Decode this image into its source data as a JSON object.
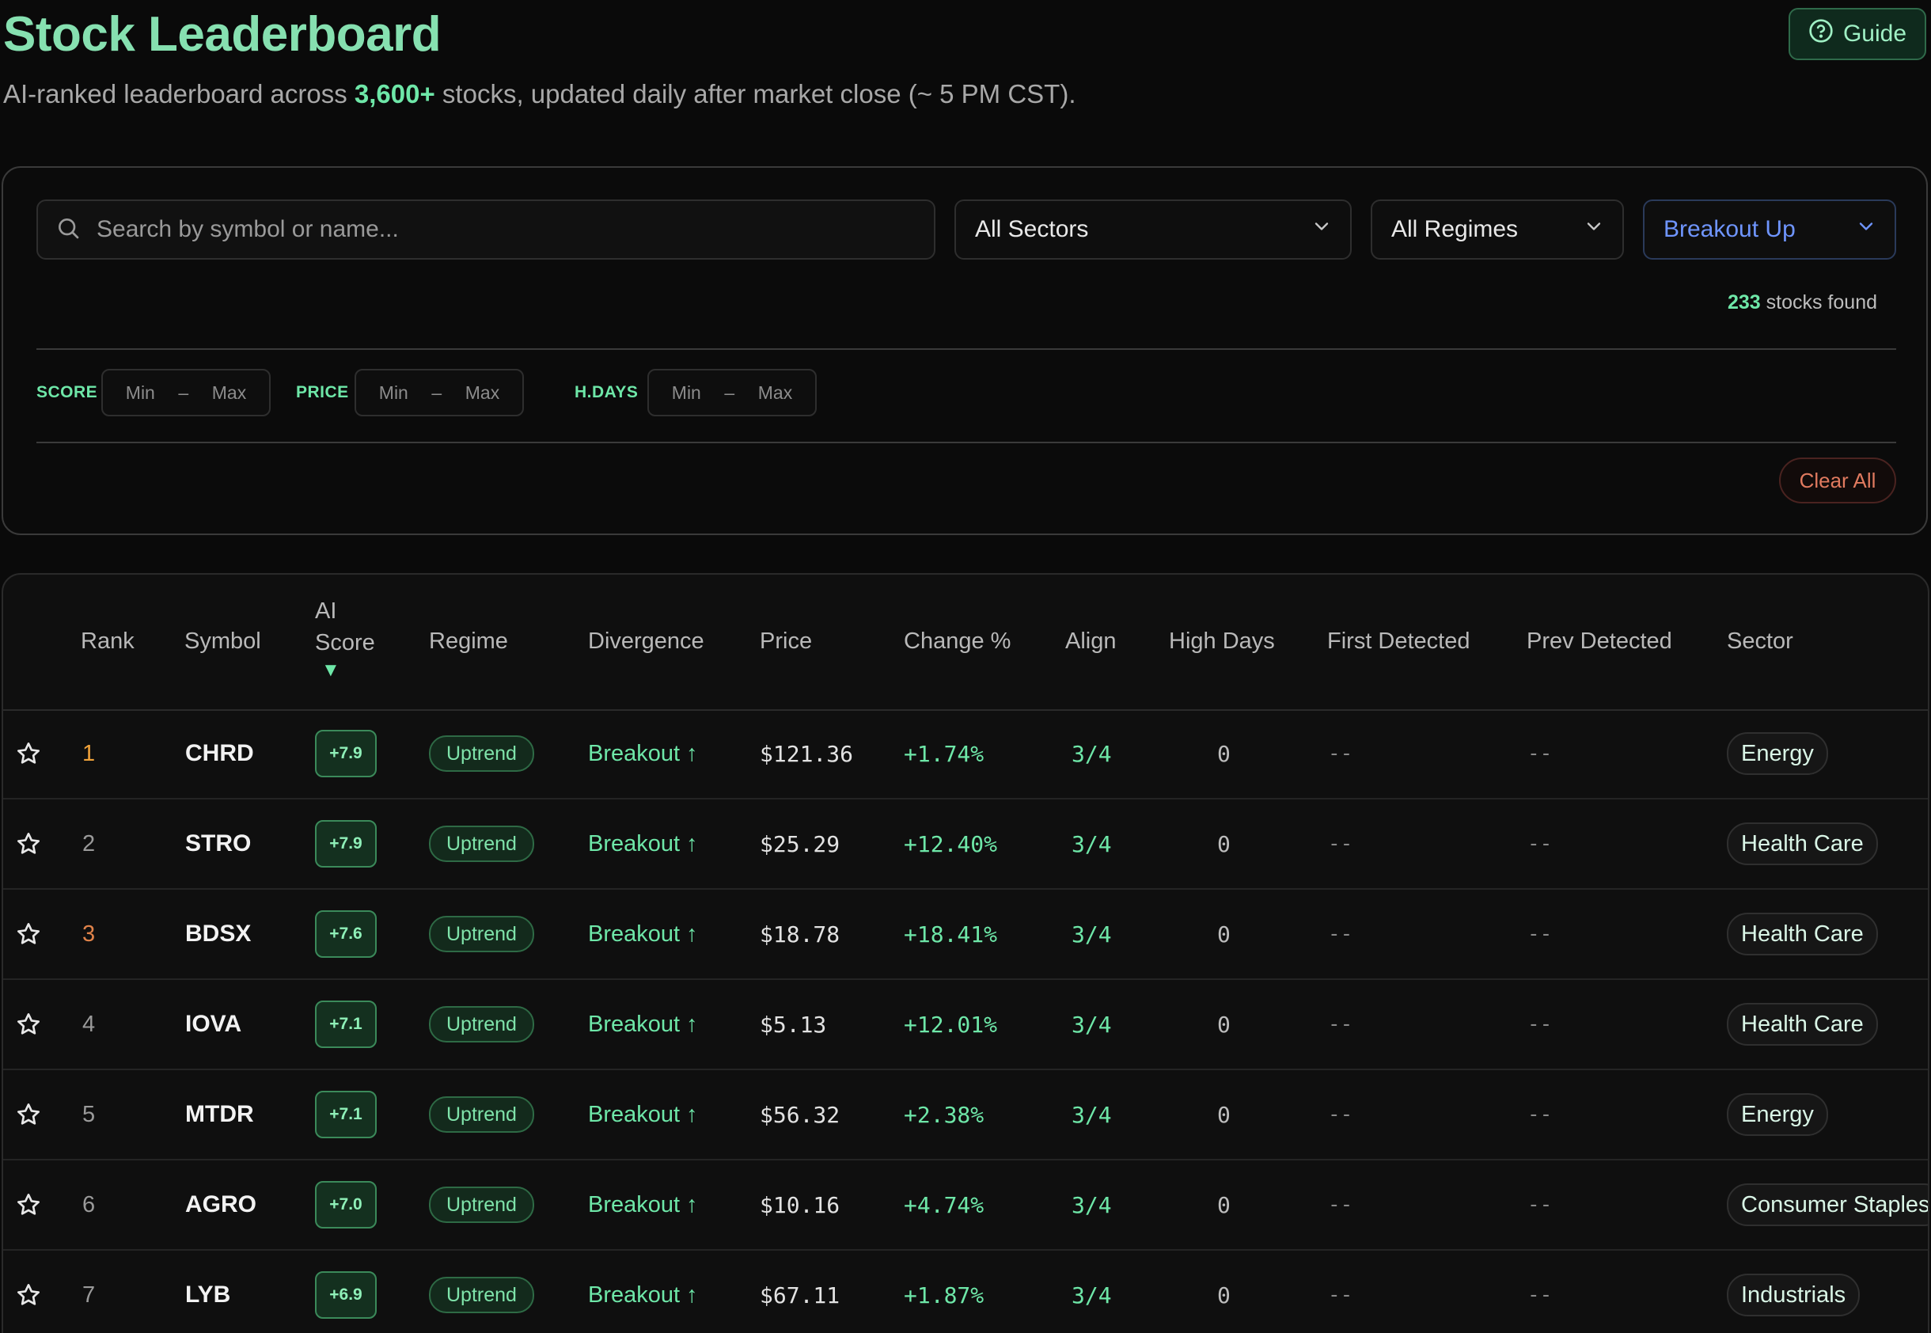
{
  "header": {
    "title": "Stock Leaderboard",
    "subtitle_prefix": "AI-ranked leaderboard across ",
    "subtitle_highlight": "3,600+",
    "subtitle_suffix": " stocks, updated daily after market close (~ 5 PM CST).",
    "guide_label": "Guide",
    "guide_icon": "help-circle-icon"
  },
  "filters": {
    "search_placeholder": "Search by symbol or name...",
    "search_value": "",
    "sector_selected": "All Sectors",
    "regime_selected": "All Regimes",
    "signal_selected": "Breakout Up",
    "found_count": "233",
    "found_label": "stocks found",
    "ranges": [
      {
        "label": "SCORE",
        "min": "Min",
        "sep": "–",
        "max": "Max"
      },
      {
        "label": "PRICE",
        "min": "Min",
        "sep": "–",
        "max": "Max"
      },
      {
        "label": "H.DAYS",
        "min": "Min",
        "sep": "–",
        "max": "Max"
      }
    ],
    "clear_label": "Clear All"
  },
  "table": {
    "columns": {
      "rank": "Rank",
      "symbol": "Symbol",
      "ai_line1": "AI",
      "ai_line2": "Score",
      "ai_sort": "▼",
      "regime": "Regime",
      "divergence": "Divergence",
      "price": "Price",
      "change": "Change %",
      "align": "Align",
      "high_days": "High Days",
      "first_detected": "First Detected",
      "prev_detected": "Prev Detected",
      "sector": "Sector"
    },
    "rows": [
      {
        "rank": "1",
        "symbol": "CHRD",
        "score": "+7.9",
        "regime": "Uptrend",
        "divergence": "Breakout ↑",
        "price": "$121.36",
        "change": "+1.74%",
        "align": "3/4",
        "high_days": "0",
        "first": "--",
        "prev": "--",
        "sector": "Energy"
      },
      {
        "rank": "2",
        "symbol": "STRO",
        "score": "+7.9",
        "regime": "Uptrend",
        "divergence": "Breakout ↑",
        "price": "$25.29",
        "change": "+12.40%",
        "align": "3/4",
        "high_days": "0",
        "first": "--",
        "prev": "--",
        "sector": "Health Care"
      },
      {
        "rank": "3",
        "symbol": "BDSX",
        "score": "+7.6",
        "regime": "Uptrend",
        "divergence": "Breakout ↑",
        "price": "$18.78",
        "change": "+18.41%",
        "align": "3/4",
        "high_days": "0",
        "first": "--",
        "prev": "--",
        "sector": "Health Care"
      },
      {
        "rank": "4",
        "symbol": "IOVA",
        "score": "+7.1",
        "regime": "Uptrend",
        "divergence": "Breakout ↑",
        "price": "$5.13",
        "change": "+12.01%",
        "align": "3/4",
        "high_days": "0",
        "first": "--",
        "prev": "--",
        "sector": "Health Care"
      },
      {
        "rank": "5",
        "symbol": "MTDR",
        "score": "+7.1",
        "regime": "Uptrend",
        "divergence": "Breakout ↑",
        "price": "$56.32",
        "change": "+2.38%",
        "align": "3/4",
        "high_days": "0",
        "first": "--",
        "prev": "--",
        "sector": "Energy"
      },
      {
        "rank": "6",
        "symbol": "AGRO",
        "score": "+7.0",
        "regime": "Uptrend",
        "divergence": "Breakout ↑",
        "price": "$10.16",
        "change": "+4.74%",
        "align": "3/4",
        "high_days": "0",
        "first": "--",
        "prev": "--",
        "sector": "Consumer Staples"
      },
      {
        "rank": "7",
        "symbol": "LYB",
        "score": "+6.9",
        "regime": "Uptrend",
        "divergence": "Breakout ↑",
        "price": "$67.11",
        "change": "+1.87%",
        "align": "3/4",
        "high_days": "0",
        "first": "--",
        "prev": "--",
        "sector": "Industrials"
      }
    ]
  },
  "colors": {
    "accent_green": "#6ee7a8",
    "title_green": "#86e0b0",
    "signal_blue": "#6f95ff",
    "clear_red": "#e07a5f",
    "rank_gold": "#f0a23a",
    "rank_bronze": "#e0834a",
    "background": "#0a0a0a"
  }
}
